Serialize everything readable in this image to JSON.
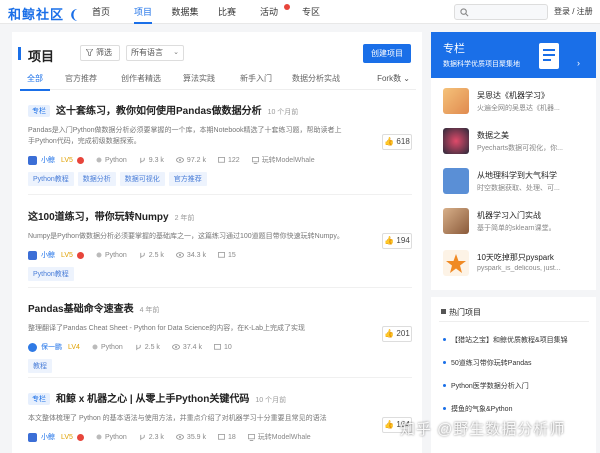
{
  "site": {
    "logo": "和鲸社区",
    "logo_mark": "❨"
  },
  "nav": [
    {
      "label": "首页",
      "active": false
    },
    {
      "label": "项目",
      "active": true
    },
    {
      "label": "数据集",
      "active": false
    },
    {
      "label": "比赛",
      "active": false
    },
    {
      "label": "活动",
      "active": false,
      "badge": true
    },
    {
      "label": "专区",
      "active": false
    }
  ],
  "header": {
    "login": "登录 / 注册",
    "search_icon": "search-icon"
  },
  "projects": {
    "title": "项目",
    "filter_label": "筛选",
    "language_select": "所有语言",
    "create_label": "创建项目",
    "tabs": [
      "全部",
      "官方推荐",
      "创作者精选",
      "算法实践",
      "新手入门",
      "数据分析实战"
    ],
    "fork_label": "Fork数",
    "items": [
      {
        "badge": "专栏",
        "title": "这十套练习，教你如何使用Pandas做数据分析",
        "time": "10 个月前",
        "desc": "Pandas是入门Python做数据分析必须要掌握的一个库，本期Notebook精选了十套练习题，帮助读者上手Python代码，完成初级数据探索。",
        "author": "小鲸",
        "level": "LV5",
        "language": "Python",
        "forks": "9.3 k",
        "views": "97.2 k",
        "comments": "122",
        "runtime": "玩转ModelWhale",
        "tags": [
          "Python教程",
          "数据分析",
          "数据可视化",
          "官方推荐"
        ],
        "likes": "618"
      },
      {
        "badge": "",
        "title": "这100道练习，带你玩转Numpy",
        "time": "2 年前",
        "desc": "Numpy是Python做数据分析必须要掌握的基础库之一，这篇练习通过100道题目带你快速玩转Numpy。",
        "author": "小鲸",
        "level": "LV5",
        "language": "Python",
        "forks": "2.5 k",
        "views": "34.3 k",
        "comments": "15",
        "runtime": "",
        "tags": [
          "Python教程"
        ],
        "likes": "194"
      },
      {
        "badge": "",
        "title": "Pandas基础命令速查表",
        "time": "4 年前",
        "desc": "整理翻译了Pandas Cheat Sheet - Python for Data Science的内容，在K-Lab上完成了实现",
        "author": "保一鹏",
        "level": "LV4",
        "language": "Python",
        "forks": "2.5 k",
        "views": "37.4 k",
        "comments": "10",
        "runtime": "",
        "tags": [
          "教程"
        ],
        "likes": "201"
      },
      {
        "badge": "专栏",
        "title": "和鲸 x 机器之心 | 从零上手Python关键代码",
        "time": "10 个月前",
        "desc": "本文整体梳理了 Python 的基本语法与使用方法，并重点介绍了对机器学习十分重要且常见的语法",
        "author": "小鲸",
        "level": "LV5",
        "language": "Python",
        "forks": "2.3 k",
        "views": "35.9 k",
        "comments": "18",
        "runtime": "玩转ModelWhale",
        "tags": [],
        "likes": "164"
      }
    ]
  },
  "column": {
    "title": "专栏",
    "subtitle": "数据科学优质项目聚集地",
    "items": [
      {
        "name": "吴恩达《机器学习》",
        "desc": "火遍全网的吴恩达《机器..."
      },
      {
        "name": "数据之美",
        "desc": "Pyecharts数据可视化，你..."
      },
      {
        "name": "从地理科学到大气科学",
        "desc": "时空数据获取、处理、可..."
      },
      {
        "name": "机器学习入门实战",
        "desc": "基于简单的sklearn课堂。"
      },
      {
        "name": "10天吃掉那只pyspark",
        "desc": "pyspark_is_delicous, just..."
      }
    ]
  },
  "hot": {
    "title": "热门项目",
    "items": [
      "【猎站之宝】和鲸优质教程&项目集锦",
      "50道练习带你玩转Pandas",
      "Python医学数据分析入门",
      "摸鱼的气象&Python"
    ]
  },
  "watermark": "知乎 @野生数据分析师",
  "colors": {
    "accent": "#1a6fe8",
    "level_gold": "#e0a000",
    "badge_red": "#e7453b"
  }
}
